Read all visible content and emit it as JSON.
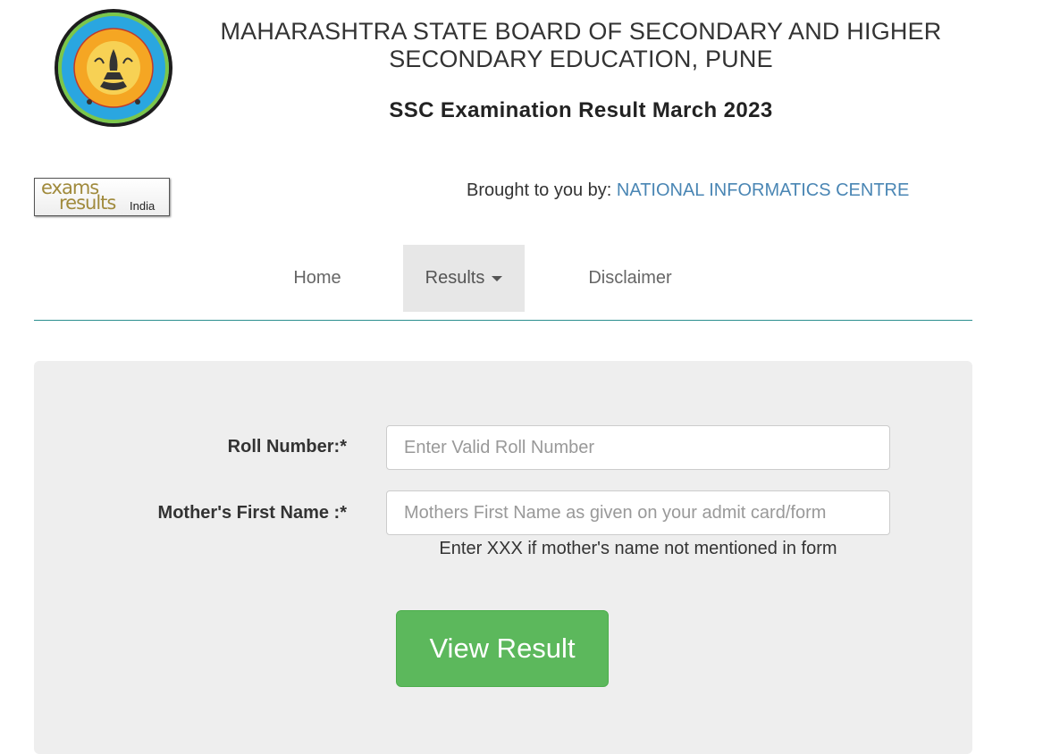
{
  "header": {
    "title": "MAHARASHTRA STATE BOARD OF SECONDARY AND HIGHER SECONDARY EDUCATION, PUNE",
    "subtitle": "SSC Examination Result March 2023"
  },
  "partner_logo": {
    "word1": "exams",
    "word2": "results",
    "word3": "India"
  },
  "credit": {
    "prefix": "Brought to you by: ",
    "org": "NATIONAL INFORMATICS CENTRE"
  },
  "nav": {
    "home": "Home",
    "results": "Results",
    "disclaimer": "Disclaimer"
  },
  "form": {
    "roll_label": "Roll Number:*",
    "roll_placeholder": "Enter Valid Roll Number",
    "mother_label": "Mother's First Name :*",
    "mother_placeholder": "Mothers First Name as given on your admit card/form",
    "mother_hint": "Enter XXX if mother's name not mentioned in form",
    "submit_label": "View Result"
  },
  "colors": {
    "seal_outer": "#2a9fd6",
    "seal_inner": "#f5a623",
    "nav_border": "#2a8f8f",
    "link": "#4a86b4",
    "button": "#5cb85c"
  }
}
